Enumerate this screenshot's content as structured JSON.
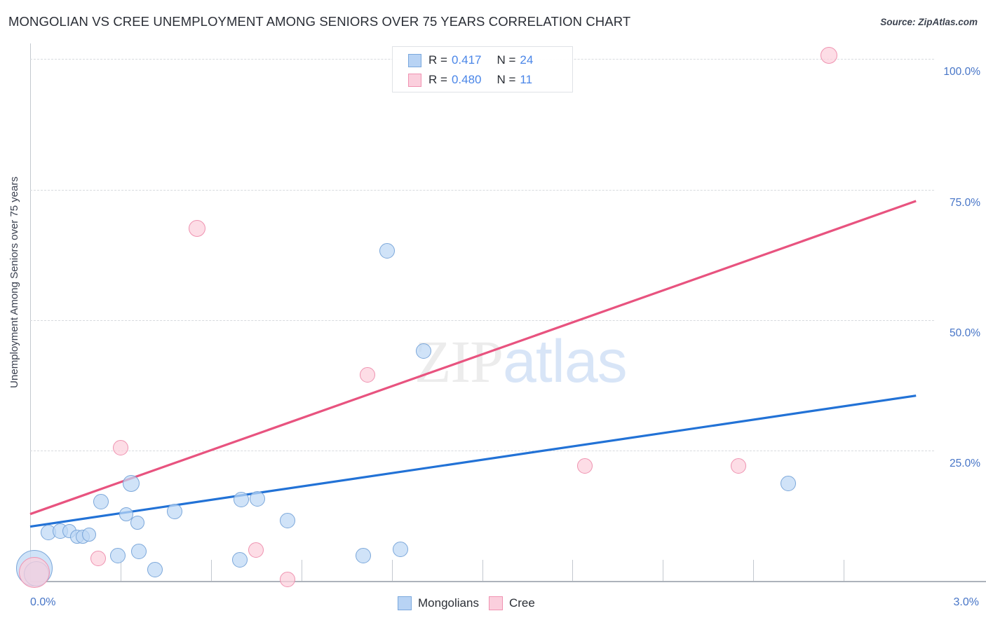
{
  "header": {
    "title": "MONGOLIAN VS CREE UNEMPLOYMENT AMONG SENIORS OVER 75 YEARS CORRELATION CHART",
    "source": "Source: ZipAtlas.com"
  },
  "watermark": {
    "zip": "ZIP",
    "atlas": "atlas"
  },
  "axes": {
    "y_title": "Unemployment Among Seniors over 75 years",
    "y_ticks": [
      "100.0%",
      "75.0%",
      "50.0%",
      "25.0%"
    ],
    "x_min_label": "0.0%",
    "x_max_label": "3.0%"
  },
  "stats": [
    {
      "series": "Mongolians",
      "color": "#b8d3f4",
      "r_label": "R =",
      "r_value": "0.417",
      "n_label": "N =",
      "n_value": "24"
    },
    {
      "series": "Cree",
      "color": "#fbcfdd",
      "r_label": "R =",
      "r_value": "0.480",
      "n_label": "N =",
      "n_value": "11"
    }
  ],
  "legend": [
    {
      "label": "Mongolians",
      "color": "#b8d3f4"
    },
    {
      "label": "Cree",
      "color": "#fbcfdd"
    }
  ],
  "chart_data": {
    "type": "scatter",
    "title": "MONGOLIAN VS CREE UNEMPLOYMENT AMONG SENIORS OVER 75 YEARS CORRELATION CHART",
    "xlabel": "",
    "ylabel": "Unemployment Among Seniors over 75 years",
    "xlim": [
      0.0,
      3.0
    ],
    "ylim": [
      0.0,
      103.0
    ],
    "x_unit": "%",
    "y_unit": "%",
    "grid": true,
    "y_gridlines": [
      25.0,
      50.0,
      75.0,
      100.0
    ],
    "legend_position": "bottom-center",
    "series": [
      {
        "name": "Mongolians",
        "color": "#b8d3f4",
        "edge_color": "#7ba7da",
        "r": 0.417,
        "n": 24,
        "trendline": {
          "x0": 0.0,
          "y0": 10.4,
          "x1": 2.94,
          "y1": 35.5
        },
        "points": [
          {
            "x": 0.015,
            "y": 2.4,
            "r": 26
          },
          {
            "x": 0.02,
            "y": 1.3,
            "r": 18
          },
          {
            "x": 0.06,
            "y": 9.3,
            "r": 11
          },
          {
            "x": 0.1,
            "y": 9.5,
            "r": 11
          },
          {
            "x": 0.13,
            "y": 9.6,
            "r": 10
          },
          {
            "x": 0.155,
            "y": 8.5,
            "r": 10
          },
          {
            "x": 0.175,
            "y": 8.4,
            "r": 10
          },
          {
            "x": 0.195,
            "y": 8.8,
            "r": 10
          },
          {
            "x": 0.235,
            "y": 15.2,
            "r": 11
          },
          {
            "x": 0.29,
            "y": 4.8,
            "r": 11
          },
          {
            "x": 0.335,
            "y": 18.7,
            "r": 12
          },
          {
            "x": 0.32,
            "y": 12.8,
            "r": 10
          },
          {
            "x": 0.355,
            "y": 11.2,
            "r": 10
          },
          {
            "x": 0.36,
            "y": 5.6,
            "r": 11
          },
          {
            "x": 0.415,
            "y": 2.1,
            "r": 11
          },
          {
            "x": 0.48,
            "y": 13.3,
            "r": 11
          },
          {
            "x": 0.695,
            "y": 4.0,
            "r": 11
          },
          {
            "x": 0.7,
            "y": 15.6,
            "r": 11
          },
          {
            "x": 0.755,
            "y": 15.7,
            "r": 11
          },
          {
            "x": 0.855,
            "y": 11.5,
            "r": 11
          },
          {
            "x": 1.105,
            "y": 4.8,
            "r": 11
          },
          {
            "x": 1.23,
            "y": 6.0,
            "r": 11
          },
          {
            "x": 1.185,
            "y": 63.3,
            "r": 11
          },
          {
            "x": 1.305,
            "y": 44.0,
            "r": 11
          },
          {
            "x": 2.515,
            "y": 18.6,
            "r": 11
          }
        ]
      },
      {
        "name": "Cree",
        "color": "#fbcfdd",
        "edge_color": "#ef92b0",
        "r": 0.48,
        "n": 11,
        "trendline": {
          "x0": 0.0,
          "y0": 12.8,
          "x1": 2.94,
          "y1": 72.8
        },
        "points": [
          {
            "x": 0.015,
            "y": 1.6,
            "r": 22
          },
          {
            "x": 0.225,
            "y": 4.3,
            "r": 11
          },
          {
            "x": 0.3,
            "y": 25.5,
            "r": 11
          },
          {
            "x": 0.555,
            "y": 67.5,
            "r": 12
          },
          {
            "x": 0.75,
            "y": 5.9,
            "r": 11
          },
          {
            "x": 0.855,
            "y": 0.3,
            "r": 11
          },
          {
            "x": 1.12,
            "y": 39.5,
            "r": 11
          },
          {
            "x": 1.84,
            "y": 22.0,
            "r": 11
          },
          {
            "x": 2.35,
            "y": 22.0,
            "r": 11
          },
          {
            "x": 2.65,
            "y": 100.7,
            "r": 12
          }
        ]
      }
    ]
  }
}
